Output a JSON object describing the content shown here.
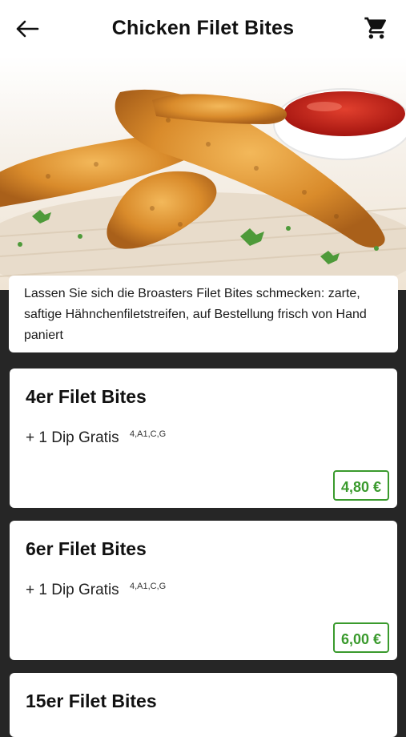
{
  "header": {
    "title": "Chicken Filet Bites",
    "back_icon": "arrow-left-icon",
    "cart_icon": "cart-icon"
  },
  "description": "Lassen Sie sich die Broasters Filet Bites schmecken: zarte, saftige Hähnchenfiletstreifen, auf Bestellung frisch von Hand paniert",
  "items": [
    {
      "name": "4er Filet Bites",
      "extra": "+ 1 Dip Gratis",
      "allergens": "4,A1,C,G",
      "price": "4,80 €"
    },
    {
      "name": "6er Filet Bites",
      "extra": "+ 1 Dip Gratis",
      "allergens": "4,A1,C,G",
      "price": "6,00 €"
    },
    {
      "name": "15er Filet Bites"
    }
  ],
  "colors": {
    "accent": "#3a9a2d",
    "background": "#262626"
  }
}
